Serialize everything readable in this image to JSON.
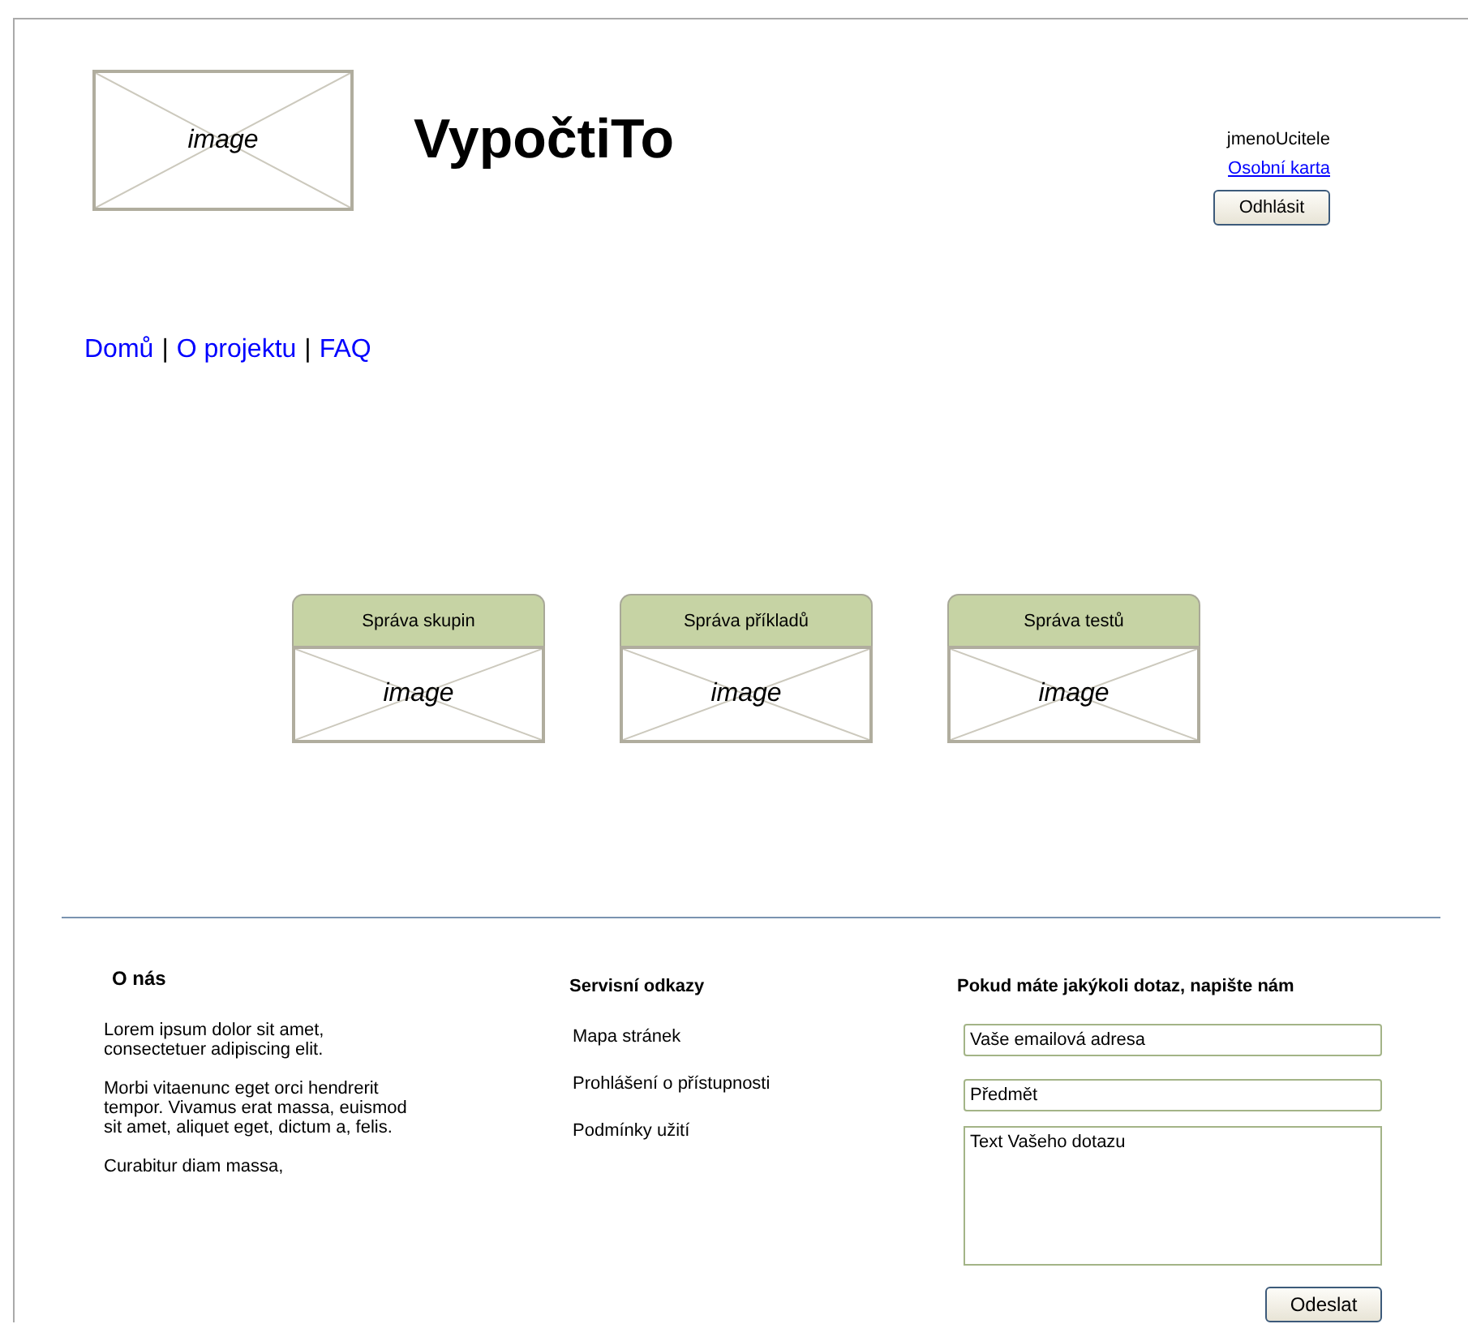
{
  "header": {
    "logo_placeholder": "image",
    "title": "VypočtiTo",
    "user_name": "jmenoUcitele",
    "profile_link": "Osobní karta",
    "logout_button": "Odhlásit"
  },
  "nav": {
    "links": [
      "Domů",
      "O projektu",
      "FAQ"
    ],
    "separator": "|"
  },
  "tiles": [
    {
      "title": "Správa skupin",
      "placeholder": "image"
    },
    {
      "title": "Správa příkladů",
      "placeholder": "image"
    },
    {
      "title": "Správa testů",
      "placeholder": "image"
    }
  ],
  "footer": {
    "about": {
      "heading": "O nás",
      "paragraphs": [
        "Lorem ipsum dolor sit amet, consectetuer adipiscing elit.",
        "Morbi vitaenunc eget orci hendrerit tempor. Vivamus erat massa, euismod sit amet, aliquet eget, dictum a, felis.",
        "Curabitur diam massa,"
      ]
    },
    "service": {
      "heading": "Servisní odkazy",
      "links": [
        "Mapa stránek",
        "Prohlášení o přístupnosti",
        "Podmínky užití"
      ]
    },
    "contact": {
      "heading": "Pokud máte jakýkoli dotaz, napište nám",
      "email_field": {
        "value": "Vaše emailová adresa"
      },
      "subject_field": {
        "value": "Předmět"
      },
      "message_field": {
        "value": "Text Vašeho dotazu"
      },
      "submit_button": "Odeslat"
    }
  }
}
